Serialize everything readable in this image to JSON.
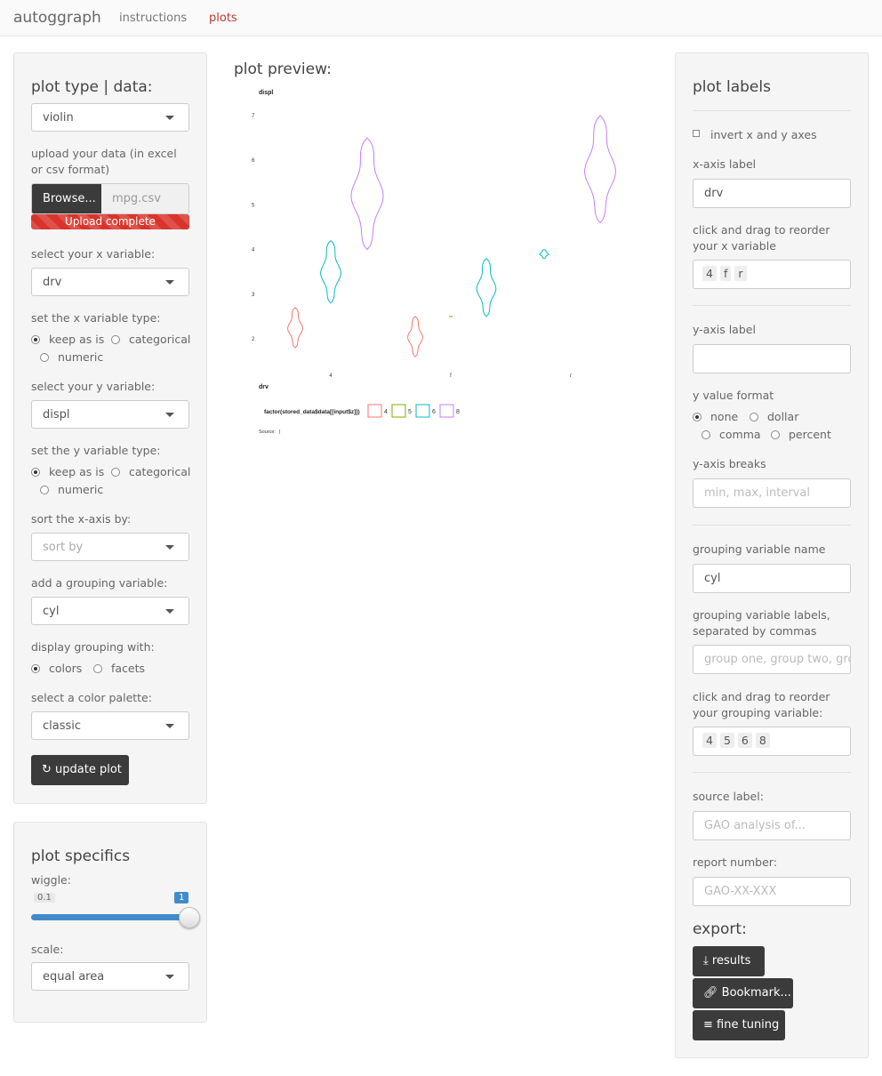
{
  "nav": {
    "brand": "autoggraph",
    "tabs": [
      {
        "label": "instructions"
      },
      {
        "label": "plots"
      }
    ]
  },
  "left": {
    "title": "plot type | data:",
    "plot_type": "violin",
    "upload_label": "upload your data (in excel or csv format)",
    "browse_label": "Browse...",
    "file_name": "mpg.csv",
    "upload_status": "Upload complete",
    "x_label": "select your x variable:",
    "x_value": "drv",
    "x_type_label": "set the x variable type:",
    "x_type_options": [
      "keep as is",
      "categorical",
      "numeric"
    ],
    "y_label": "select your y variable:",
    "y_value": "displ",
    "y_type_label": "set the y variable type:",
    "y_type_options": [
      "keep as is",
      "categorical",
      "numeric"
    ],
    "sort_label": "sort the x-axis by:",
    "sort_placeholder": "sort by",
    "group_label": "add a grouping variable:",
    "group_value": "cyl",
    "display_label": "display grouping with:",
    "display_options": [
      "colors",
      "facets"
    ],
    "palette_label": "select a color palette:",
    "palette_value": "classic",
    "update_button": "update plot"
  },
  "specifics": {
    "title": "plot specifics",
    "wiggle_label": "wiggle:",
    "wiggle_min": "0.1",
    "wiggle_value": "1",
    "wiggle_fraction": 1.0,
    "scale_label": "scale:",
    "scale_value": "equal area"
  },
  "preview": {
    "title": "plot preview:"
  },
  "chart_data": {
    "type": "violin",
    "ylabel": "displ",
    "xlabel": "drv",
    "categories": [
      "4",
      "f",
      "r"
    ],
    "y_ticks": [
      "2",
      "3",
      "4",
      "5",
      "6",
      "7"
    ],
    "legend_title": "factor(stored_data$data[[input$z]])",
    "series": [
      {
        "name": "4",
        "color": "#f8766d",
        "violins": [
          {
            "x": "4",
            "min": 1.8,
            "max": 2.7
          },
          {
            "x": "f",
            "min": 1.6,
            "max": 2.5
          }
        ]
      },
      {
        "name": "5",
        "color": "#7cae00",
        "violins": [
          {
            "x": "f",
            "min": 2.5,
            "max": 2.5
          }
        ]
      },
      {
        "name": "6",
        "color": "#00bfc4",
        "violins": [
          {
            "x": "4",
            "min": 2.8,
            "max": 4.2
          },
          {
            "x": "f",
            "min": 2.5,
            "max": 3.8
          },
          {
            "x": "r",
            "min": 3.8,
            "max": 4.0
          }
        ]
      },
      {
        "name": "8",
        "color": "#c77cff",
        "violins": [
          {
            "x": "4",
            "min": 4.0,
            "max": 6.5
          },
          {
            "x": "r",
            "min": 4.6,
            "max": 7.0
          }
        ]
      }
    ],
    "source_label": "Source:",
    "source_value": "|"
  },
  "right": {
    "title": "plot labels",
    "invert_label": "invert x and y axes",
    "xaxis_label": "x-axis label",
    "xaxis_value": "drv",
    "reorder_x_label": "click and drag to reorder your x variable",
    "x_levels": [
      "4",
      "f",
      "r"
    ],
    "yaxis_label": "y-axis label",
    "yaxis_value": "",
    "yformat_label": "y value format",
    "yformat_options": [
      "none",
      "dollar",
      "comma",
      "percent"
    ],
    "ybreaks_label": "y-axis breaks",
    "ybreaks_placeholder": "min, max, interval",
    "group_name_label": "grouping variable name",
    "group_name_value": "cyl",
    "group_labels_label": "grouping variable labels, separated by commas",
    "group_labels_placeholder": "group one, group two, gro",
    "reorder_group_label": "click and drag to reorder your grouping variable:",
    "group_levels": [
      "4",
      "5",
      "6",
      "8"
    ],
    "source_label": "source label:",
    "source_placeholder": "GAO analysis of...",
    "report_label": "report number:",
    "report_placeholder": "GAO-XX-XXX",
    "export_title": "export:",
    "export_buttons": [
      "results",
      "Bookmark...",
      "fine tuning"
    ]
  }
}
